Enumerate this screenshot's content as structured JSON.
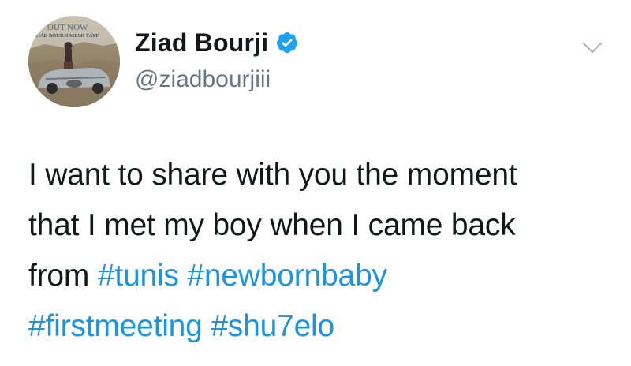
{
  "tweet": {
    "author": {
      "display_name": "Ziad Bourji",
      "handle": "@ziadbourjiii",
      "verified": true
    },
    "avatar": {
      "overlay_top": "OUT NOW",
      "overlay_bottom": "ZIAD BOURJI MESH TAYE"
    },
    "menu_icon": "chevron-down-icon",
    "body": {
      "line1": "I want to share with you the moment",
      "line2": "that I met my boy when I came back",
      "line3_prefix": "from ",
      "hashtags": [
        "#tunis",
        "#newbornbaby",
        "#firstmeeting",
        "#shu7elo"
      ]
    }
  },
  "colors": {
    "text": "#14171a",
    "secondary": "#657786",
    "link": "#1b95e0",
    "verified": "#1da1f2"
  }
}
